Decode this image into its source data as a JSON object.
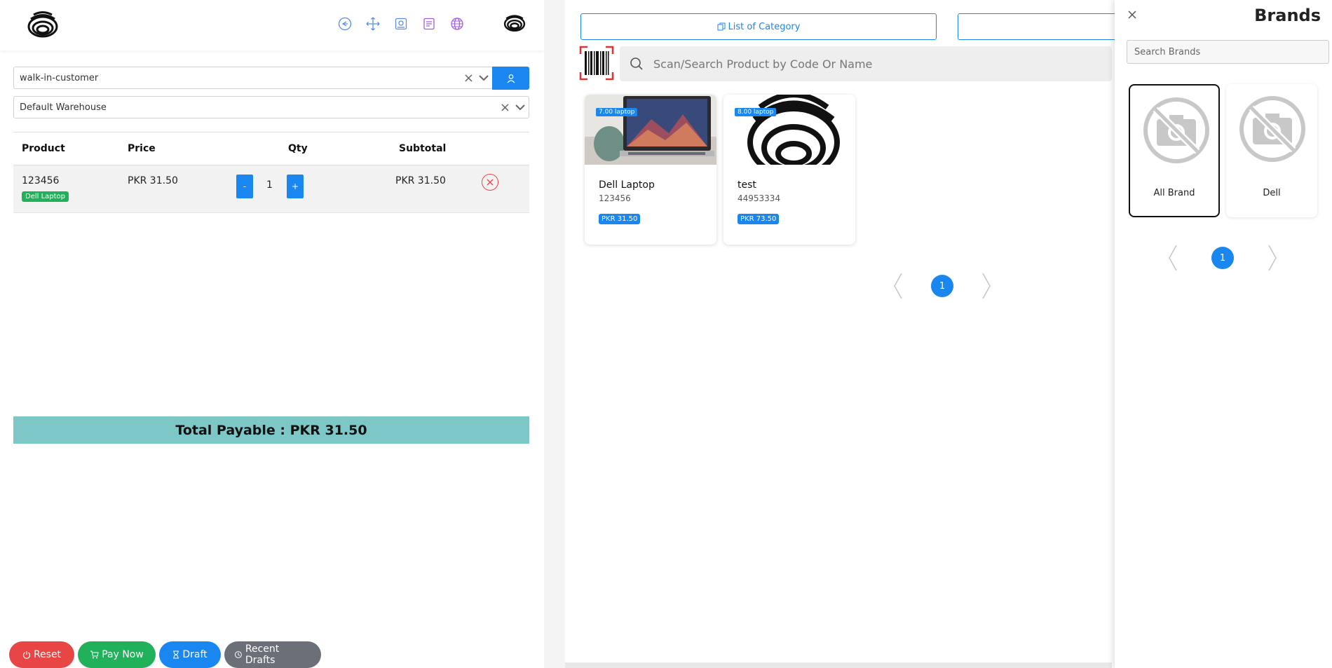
{
  "header": {
    "icons": [
      "logout-icon",
      "fullscreen-icon",
      "pos-settings-icon",
      "report-icon",
      "language-icon"
    ]
  },
  "customer": {
    "value": "walk-in-customer",
    "clear": "×",
    "caret": "⌄"
  },
  "warehouse": {
    "value": "Default Warehouse",
    "clear": "×",
    "caret": "⌄"
  },
  "cart": {
    "columns": [
      "Product",
      "Price",
      "Qty",
      "Subtotal"
    ],
    "rows": [
      {
        "code": "123456",
        "name": "Dell Laptop",
        "price": "PKR 31.50",
        "qty": "1",
        "subtotal": "PKR 31.50",
        "minus": "-",
        "plus": "+"
      }
    ]
  },
  "total": {
    "label": "Total Payable : PKR 31.50"
  },
  "actions": {
    "reset": "Reset",
    "pay_now": "Pay Now",
    "draft": "Draft",
    "recent_drafts": "Recent Drafts"
  },
  "catalog": {
    "list_category": "List of Category",
    "search_placeholder": "Scan/Search Product by Code Or Name",
    "products": [
      {
        "stock": "7.00 laptop",
        "name": "Dell Laptop",
        "code": "123456",
        "price": "PKR 31.50"
      },
      {
        "stock": "8.00 laptop",
        "name": "test",
        "code": "44953334",
        "price": "PKR 73.50"
      }
    ],
    "current_page": "1"
  },
  "brands_drawer": {
    "title": "Brands",
    "search_placeholder": "Search Brands",
    "brands": [
      {
        "label": "All Brand",
        "active": true
      },
      {
        "label": "Dell",
        "active": false
      }
    ],
    "current_page": "1"
  },
  "colors": {
    "primary": "#1a86f0",
    "success": "#20b15a",
    "danger": "#e84545",
    "total_bar": "#7ec7c7",
    "secondary": "#6b7078"
  }
}
